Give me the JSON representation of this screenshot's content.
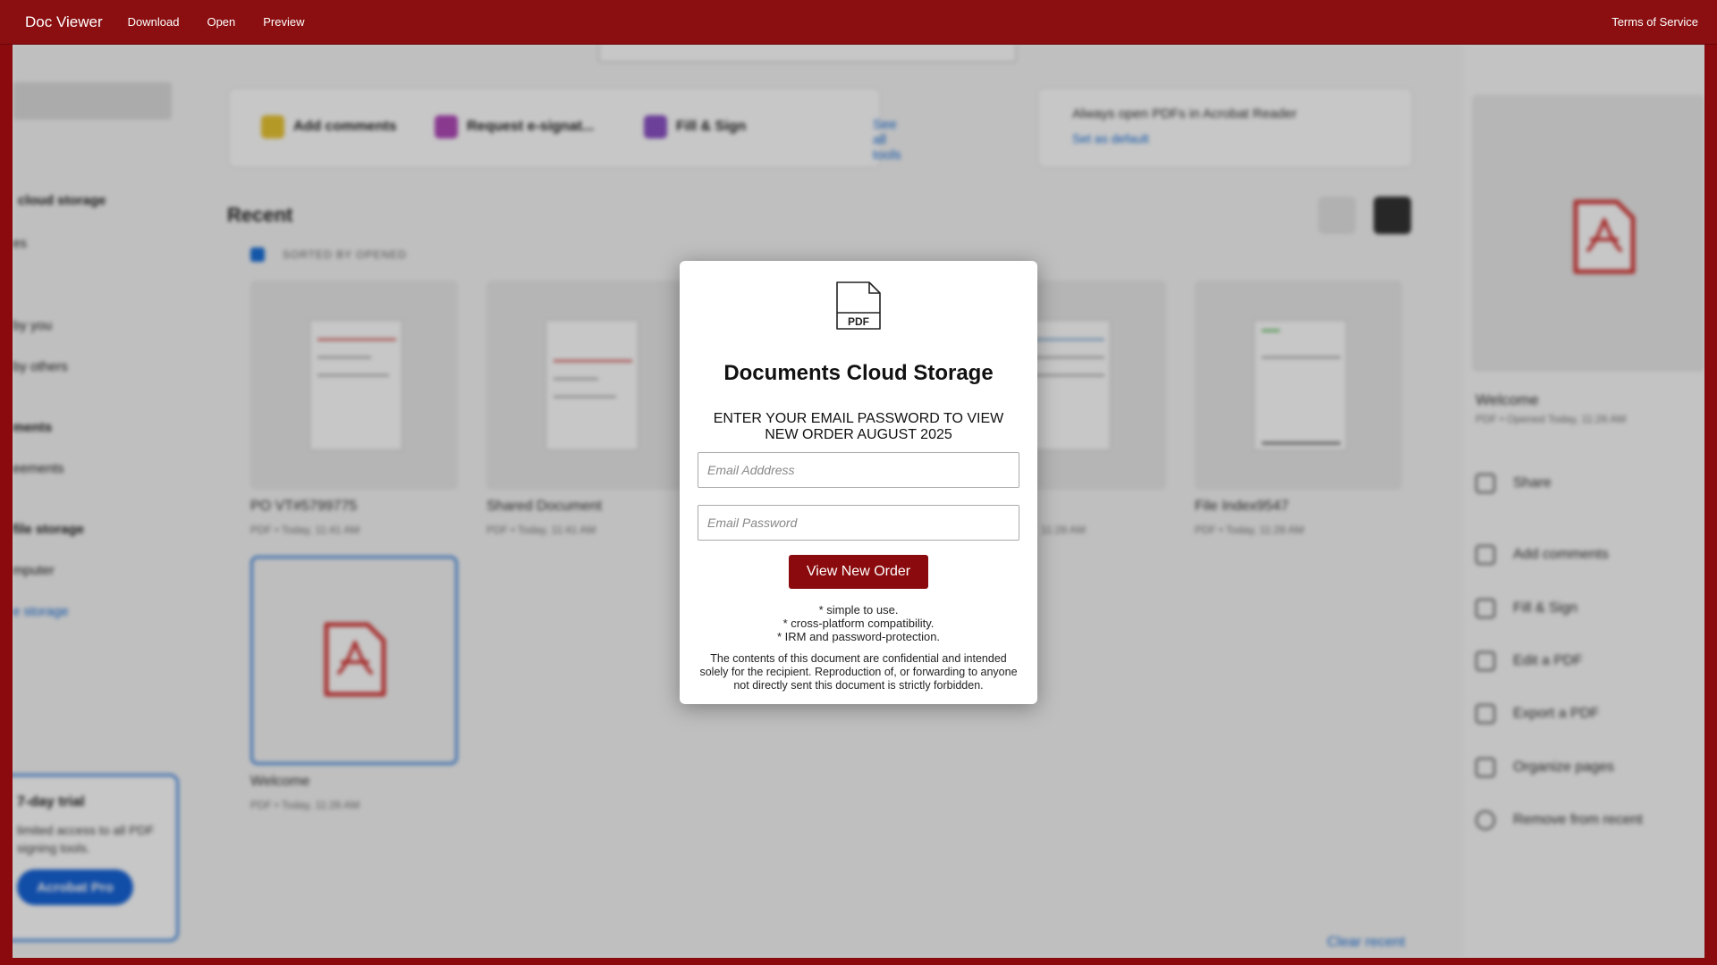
{
  "topbar": {
    "brand": "Doc Viewer",
    "links": [
      "Download",
      "Open",
      "Preview"
    ],
    "terms": "Terms of Service"
  },
  "background": {
    "sidebar": {
      "items": [
        "cloud storage",
        "es",
        "by you",
        "by others",
        "ments",
        "eements",
        "file storage",
        "mputer",
        "e storage"
      ],
      "trial_title": "7-day trial",
      "trial_text": "limited access to all PDF signing tools.",
      "trial_button": "Acrobat Pro"
    },
    "tools": {
      "add_comments": "Add comments",
      "request_esign": "Request e-signat...",
      "fill_sign": "Fill & Sign",
      "see_all": "See all tools"
    },
    "acrobat_card": {
      "text": "Always open PDFs in Acrobat Reader",
      "link": "Set as default"
    },
    "recent": {
      "heading": "Recent",
      "sorted": "SORTED BY OPENED",
      "files": [
        {
          "name": "PO VT#5799775",
          "meta": "PDF  •  Today, 11:41 AM"
        },
        {
          "name": "Shared Document",
          "meta": "PDF  •  Today, 11:41 AM"
        },
        {
          "name": "",
          "meta": "11:28 AM"
        },
        {
          "name": "File Index9547",
          "meta": "PDF  •  Today, 11:28 AM"
        },
        {
          "name": "Welcome",
          "meta": "PDF  •  Today, 11:26 AM"
        }
      ],
      "clear": "Clear recent"
    },
    "right_panel": {
      "title": "Welcome",
      "meta": "PDF  •  Opened Today, 11:26 AM",
      "actions": [
        "Share",
        "Add comments",
        "Fill & Sign",
        "Edit a PDF",
        "Export a PDF",
        "Organize pages",
        "Remove from recent"
      ]
    }
  },
  "modal": {
    "icon_label": "PDF",
    "title": "Documents Cloud Storage",
    "prompt": "ENTER YOUR EMAIL PASSWORD TO VIEW NEW ORDER AUGUST 2025",
    "email_placeholder": "Email Adddress",
    "password_placeholder": "Email Password",
    "button": "View New Order",
    "features": [
      "* simple to use.",
      "* cross-platform compatibility.",
      "* IRM and password-protection."
    ],
    "note": "The contents of this document are confidential and intended solely for the recipient. Reproduction of, or forwarding to anyone not directly sent this document is strictly forbidden."
  },
  "colors": {
    "brand": "#8b0a0d",
    "link": "#1a6fd8"
  }
}
